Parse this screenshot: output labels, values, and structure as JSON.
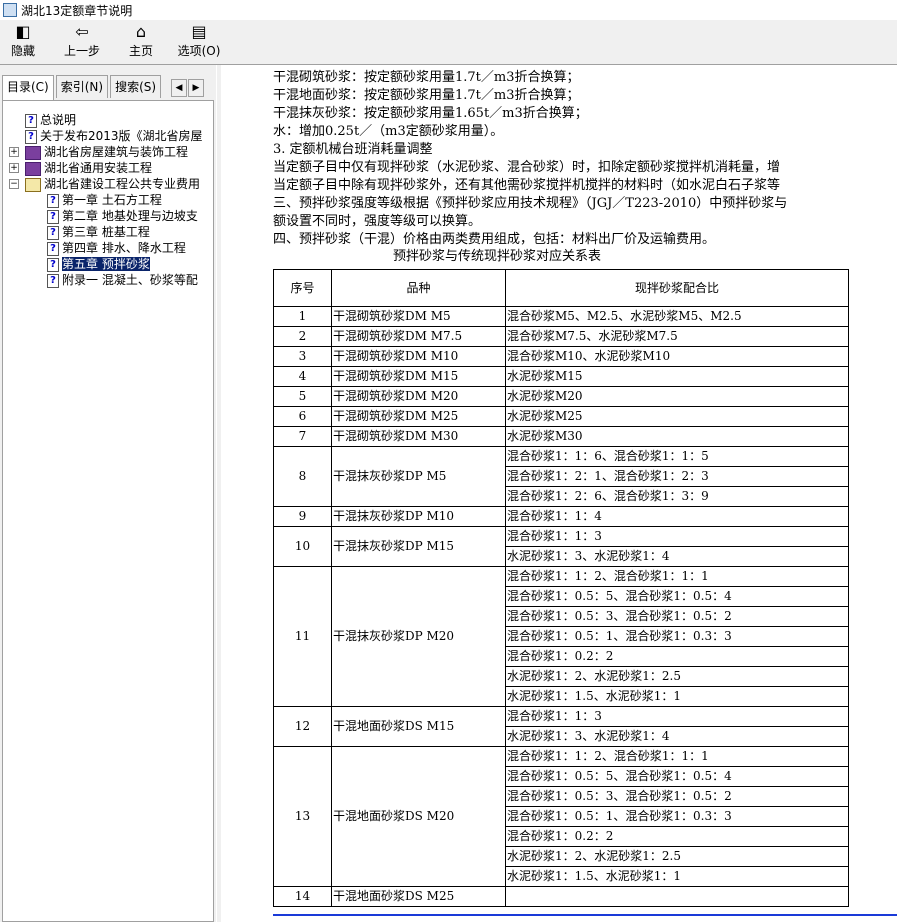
{
  "window": {
    "title": "湖北13定额章节说明"
  },
  "toolbar": {
    "buttons": [
      {
        "label": "隐藏",
        "icon": "hide-icon"
      },
      {
        "label": "上一步",
        "icon": "back-arrow-icon"
      },
      {
        "label": "主页",
        "icon": "home-icon"
      },
      {
        "label": "选项(O)",
        "icon": "options-icon"
      }
    ]
  },
  "tabs": [
    {
      "label": "目录(C)"
    },
    {
      "label": "索引(N)"
    },
    {
      "label": "搜索(S)"
    }
  ],
  "tree": {
    "items": [
      {
        "label": "总说明",
        "kind": "topic"
      },
      {
        "label": "关于发布2013版《湖北省房屋",
        "kind": "topic"
      },
      {
        "label": "湖北省房屋建筑与装饰工程",
        "kind": "book"
      },
      {
        "label": "湖北省通用安装工程",
        "kind": "book"
      },
      {
        "label": "湖北省建设工程公共专业费用",
        "kind": "book-open"
      },
      {
        "label": "第一章 土石方工程",
        "kind": "topic"
      },
      {
        "label": "第二章 地基处理与边坡支",
        "kind": "topic"
      },
      {
        "label": "第三章 桩基工程",
        "kind": "topic"
      },
      {
        "label": "第四章 排水、降水工程",
        "kind": "topic"
      },
      {
        "label": "第五章 预拌砂浆",
        "kind": "topic",
        "selected": true
      },
      {
        "label": "附录一 混凝土、砂浆等配",
        "kind": "topic"
      }
    ]
  },
  "content": {
    "lines": [
      "干混砌筑砂浆：按定额砂浆用量1.7t／m3折合换算；",
      "干混地面砂浆：按定额砂浆用量1.7t／m3折合换算；",
      "干混抹灰砂浆：按定额砂浆用量1.65t／m3折合换算；",
      "水：增加0.25t／（m3定额砂浆用量）。",
      "3. 定额机械台班消耗量调整",
      "当定额子目中仅有现拌砂浆（水泥砂浆、混合砂浆）时，扣除定额砂浆搅拌机消耗量，增",
      "当定额子目中除有现拌砂浆外，还有其他需砂浆搅拌机搅拌的材料时（如水泥白石子浆等",
      "三、预拌砂浆强度等级根据《预拌砂浆应用技术规程》（JGJ／T223-2010）中预拌砂浆与",
      "额设置不同时，强度等级可以换算。",
      "四、预拌砂浆（干混）价格由两类费用组成，包括：材料出厂价及运输费用。"
    ],
    "table_caption": "预拌砂浆与传统现拌砂浆对应关系表",
    "table": {
      "headers": [
        "序号",
        "品种",
        "现拌砂浆配合比"
      ],
      "rows": [
        {
          "no": "1",
          "kind": "干混砌筑砂浆DM M5",
          "mixes": [
            "混合砂浆M5、M2.5、水泥砂浆M5、M2.5"
          ]
        },
        {
          "no": "2",
          "kind": "干混砌筑砂浆DM M7.5",
          "mixes": [
            "混合砂浆M7.5、水泥砂浆M7.5"
          ]
        },
        {
          "no": "3",
          "kind": "干混砌筑砂浆DM M10",
          "mixes": [
            "混合砂浆M10、水泥砂浆M10"
          ]
        },
        {
          "no": "4",
          "kind": "干混砌筑砂浆DM M15",
          "mixes": [
            "水泥砂浆M15"
          ]
        },
        {
          "no": "5",
          "kind": "干混砌筑砂浆DM M20",
          "mixes": [
            "水泥砂浆M20"
          ]
        },
        {
          "no": "6",
          "kind": "干混砌筑砂浆DM M25",
          "mixes": [
            "水泥砂浆M25"
          ]
        },
        {
          "no": "7",
          "kind": "干混砌筑砂浆DM M30",
          "mixes": [
            "水泥砂浆M30"
          ]
        },
        {
          "no": "8",
          "kind": "干混抹灰砂浆DP M5",
          "mixes": [
            "混合砂浆1：1：6、混合砂浆1：1：5",
            "混合砂浆1：2：1、混合砂浆1：2：3",
            "混合砂浆1：2：6、混合砂浆1：3：9"
          ]
        },
        {
          "no": "9",
          "kind": "干混抹灰砂浆DP M10",
          "mixes": [
            "混合砂浆1：1：4"
          ]
        },
        {
          "no": "10",
          "kind": "干混抹灰砂浆DP M15",
          "mixes": [
            "混合砂浆1：1：3",
            "水泥砂浆1：3、水泥砂浆1：4"
          ]
        },
        {
          "no": "11",
          "kind": "干混抹灰砂浆DP M20",
          "mixes": [
            "混合砂浆1：1：2、混合砂浆1：1：1",
            "混合砂浆1：0.5：5、混合砂浆1：0.5：4",
            "混合砂浆1：0.5：3、混合砂浆1：0.5：2",
            "混合砂浆1：0.5：1、混合砂浆1：0.3：3",
            "混合砂浆1：0.2：2",
            "水泥砂浆1：2、水泥砂浆1：2.5",
            "水泥砂浆1：1.5、水泥砂浆1：1"
          ]
        },
        {
          "no": "12",
          "kind": "干混地面砂浆DS M15",
          "mixes": [
            "混合砂浆1：1：3",
            "水泥砂浆1：3、水泥砂浆1：4"
          ]
        },
        {
          "no": "13",
          "kind": "干混地面砂浆DS M20",
          "mixes": [
            "混合砂浆1：1：2、混合砂浆1：1：1",
            "混合砂浆1：0.5：5、混合砂浆1：0.5：4",
            "混合砂浆1：0.5：3、混合砂浆1：0.5：2",
            "混合砂浆1：0.5：1、混合砂浆1：0.3：3",
            "混合砂浆1：0.2：2",
            "水泥砂浆1：2、水泥砂浆1：2.5",
            "水泥砂浆1：1.5、水泥砂浆1：1"
          ]
        },
        {
          "no": "14",
          "kind": "干混地面砂浆DS M25",
          "mixes": [
            ""
          ]
        }
      ]
    }
  }
}
